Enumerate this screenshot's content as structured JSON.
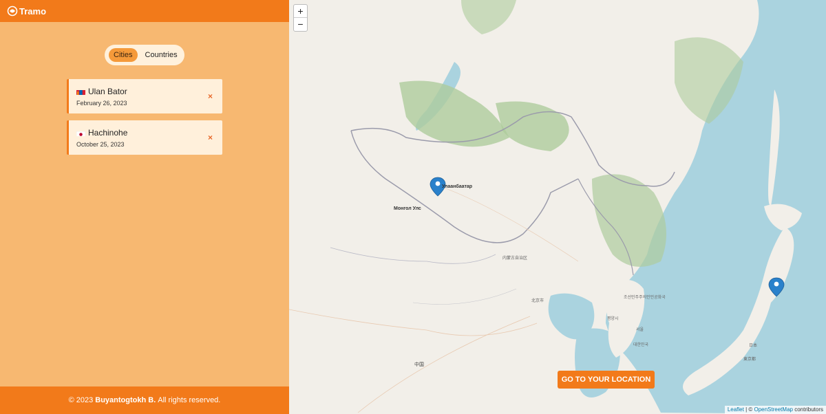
{
  "app": {
    "name": "Tramo"
  },
  "tabs": {
    "cities": "Cities",
    "countries": "Countries",
    "active": "Cities"
  },
  "cards": [
    {
      "city": "Ulan Bator",
      "date": "February 26, 2023",
      "flag": "mongolia-flag",
      "close": "×"
    },
    {
      "city": "Hachinohe",
      "date": "October 25, 2023",
      "flag": "japan-flag",
      "close": "×"
    }
  ],
  "footer": {
    "prefix": "© 2023",
    "author": "Buyantogtokh B.",
    "suffix": "All rights reserved."
  },
  "map": {
    "zoom_in": "+",
    "zoom_out": "−",
    "locate_label": "GO TO YOUR LOCATION",
    "attribution": {
      "leaflet": "Leaflet",
      "sep": " | © ",
      "osm": "OpenStreetMap",
      "suffix": " contributors"
    },
    "labels": {
      "mongolia": "Монгол Улс",
      "ulaanbaatar": "Улаанбаатар",
      "china": "中国",
      "beijing": "北京市",
      "japan": "日本",
      "tokyo": "東京都",
      "korea": "대한민국",
      "seoul": "서울",
      "nk": "조선민주주의인민공화국",
      "pyongyang": "평양시",
      "inner_mongolia": "内蒙古自治区"
    },
    "accent": "#f27a1a",
    "water": "#aad3df",
    "forest": "#aecc9c"
  }
}
